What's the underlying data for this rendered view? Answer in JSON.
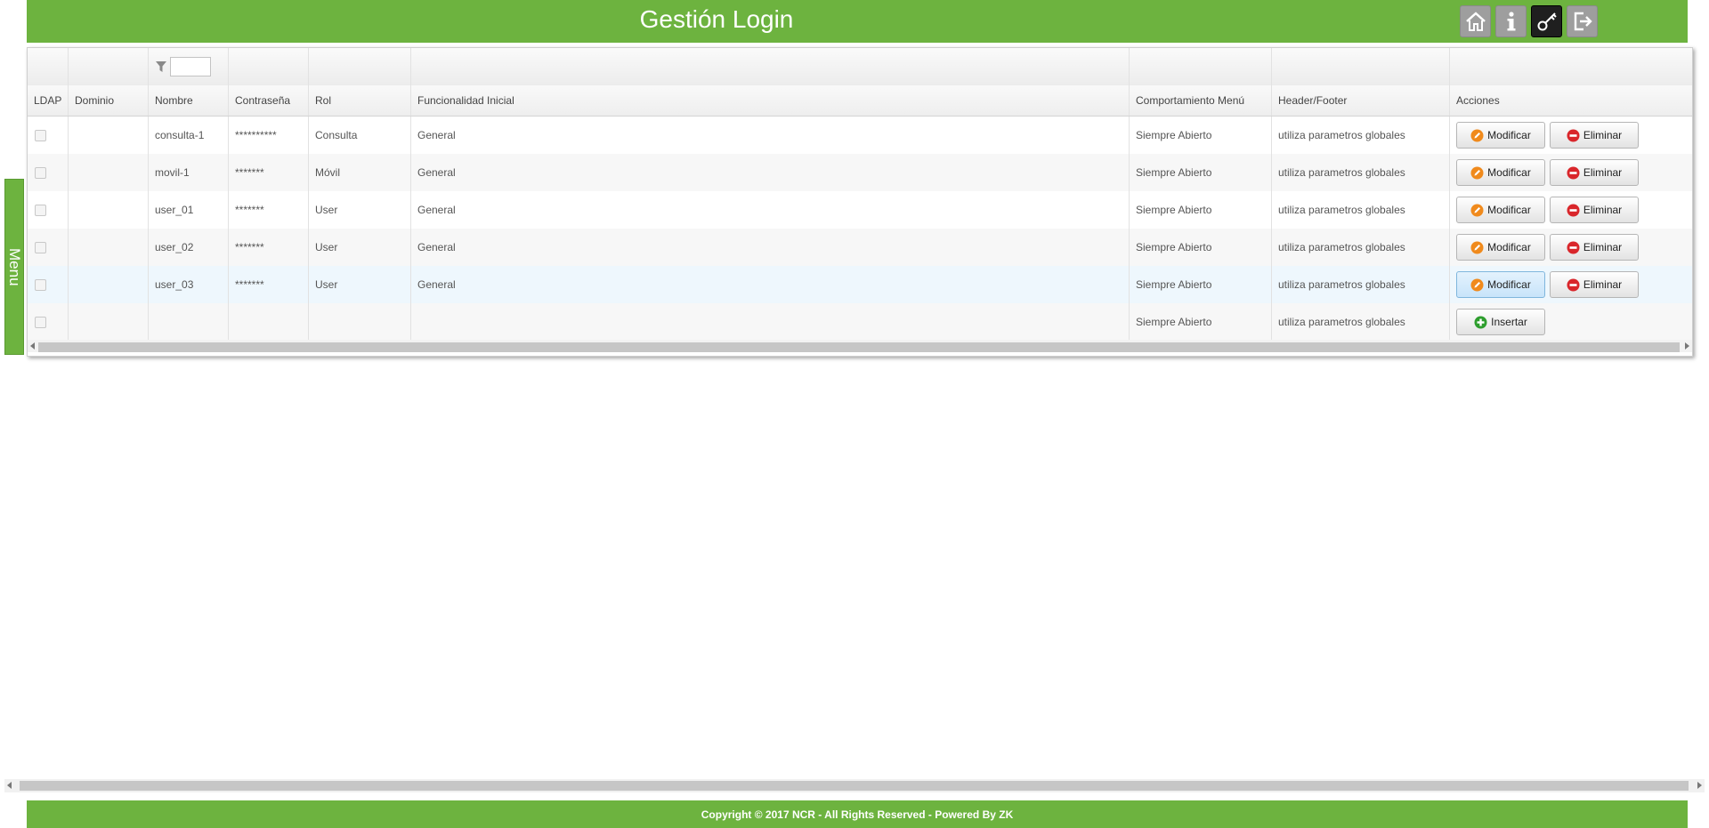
{
  "header": {
    "title": "Gestión Login",
    "buttons": [
      {
        "name": "home-button",
        "icon": "home-icon"
      },
      {
        "name": "info-button",
        "icon": "info-icon"
      },
      {
        "name": "key-button",
        "icon": "key-icon",
        "active": true
      },
      {
        "name": "logout-button",
        "icon": "logout-icon"
      }
    ]
  },
  "side_menu": {
    "label": "Menu"
  },
  "grid": {
    "filter": {
      "icon": "filter-icon",
      "value": ""
    },
    "columns": [
      "LDAP",
      "Dominio",
      "Nombre",
      "Contraseña",
      "Rol",
      "Funcionalidad Inicial",
      "Comportamiento Menú",
      "Header/Footer",
      "Acciones"
    ],
    "rows": [
      {
        "nombre": "consulta-1",
        "password": "**********",
        "rol": "Consulta",
        "func": "General",
        "comp": "Siempre Abierto",
        "hf": "utiliza parametros globales"
      },
      {
        "nombre": "movil-1",
        "password": "*******",
        "rol": "Móvil",
        "func": "General",
        "comp": "Siempre Abierto",
        "hf": "utiliza parametros globales"
      },
      {
        "nombre": "user_01",
        "password": "*******",
        "rol": "User",
        "func": "General",
        "comp": "Siempre Abierto",
        "hf": "utiliza parametros globales"
      },
      {
        "nombre": "user_02",
        "password": "*******",
        "rol": "User",
        "func": "General",
        "comp": "Siempre Abierto",
        "hf": "utiliza parametros globales"
      },
      {
        "nombre": "user_03",
        "password": "*******",
        "rol": "User",
        "func": "General",
        "comp": "Siempre Abierto",
        "hf": "utiliza parametros globales",
        "highlighted": true
      }
    ],
    "new_row": {
      "comp": "Siempre Abierto",
      "hf": "utiliza parametros globales"
    },
    "actions": {
      "modify": "Modificar",
      "delete": "Eliminar",
      "insert": "Insertar"
    }
  },
  "footer": {
    "text": "Copyright © 2017 NCR - All Rights Reserved - Powered By ZK"
  },
  "colors": {
    "brand_green": "#6db33f",
    "highlight_row": "#eef7fd",
    "alt_row": "#f7f7f7"
  }
}
